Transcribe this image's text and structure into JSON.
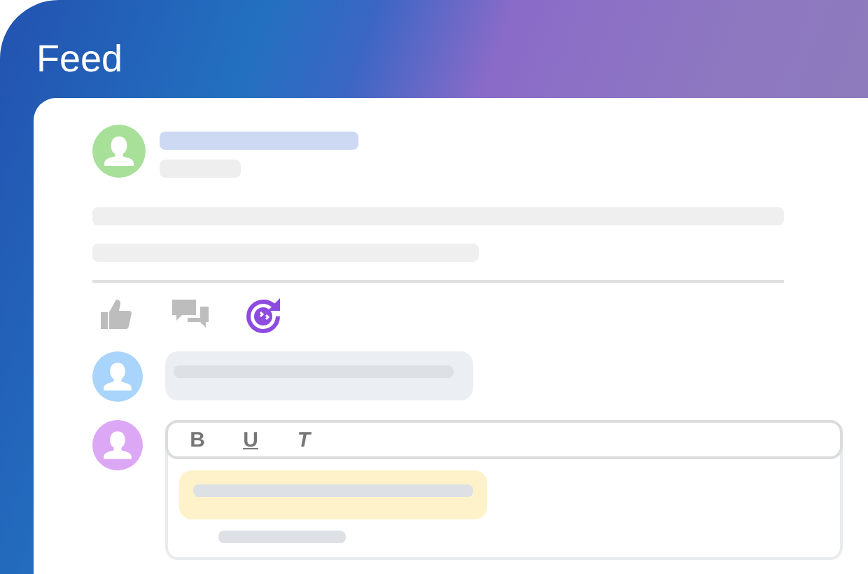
{
  "header": {
    "title": "Feed"
  },
  "post": {
    "avatar": {
      "color": "#a8e09a"
    }
  },
  "actions": [
    {
      "kind": "like",
      "selected": false
    },
    {
      "kind": "comment",
      "selected": false
    },
    {
      "kind": "boost",
      "selected": true
    }
  ],
  "comments": [
    {
      "color": "#a9d4fb"
    }
  ],
  "reply": {
    "avatar": {
      "color": "#dca8f5"
    },
    "toolbar": [
      {
        "label": "B",
        "kind": "bold"
      },
      {
        "label": "U",
        "kind": "underline"
      },
      {
        "label": "T",
        "kind": "italic"
      }
    ]
  }
}
